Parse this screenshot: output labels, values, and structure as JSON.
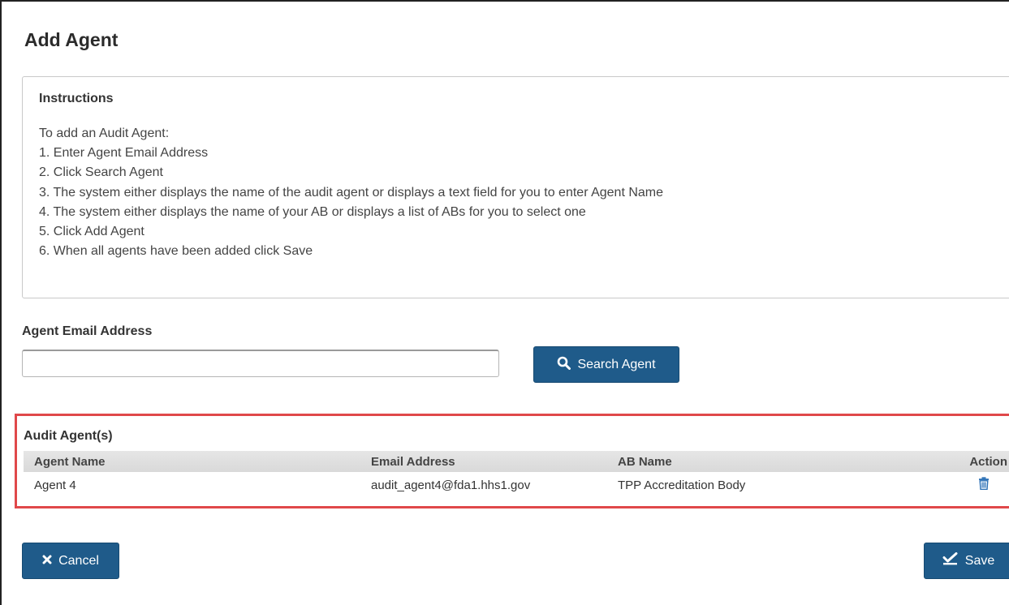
{
  "page": {
    "title": "Add Agent"
  },
  "instructions": {
    "title": "Instructions",
    "lines": [
      "To add an Audit Agent:",
      "1. Enter Agent Email Address",
      "2. Click Search Agent",
      "3. The system either displays the name of the audit agent or displays a text field for you to enter Agent Name",
      "4. The system either displays the name of your AB or displays a list of ABs for you to select one",
      "5. Click Add Agent",
      "6. When all agents have been added click Save"
    ]
  },
  "search": {
    "label": "Agent Email Address",
    "value": "",
    "placeholder": "",
    "button_label": "Search Agent",
    "button_icon": "search-icon"
  },
  "agents": {
    "title": "Audit Agent(s)",
    "columns": [
      "Agent Name",
      "Email Address",
      "AB Name",
      "Action"
    ],
    "rows": [
      {
        "agent_name": "Agent 4",
        "email": "audit_agent4@fda1.hhs1.gov",
        "ab_name": "TPP Accreditation Body",
        "action_icon": "trash-icon"
      }
    ]
  },
  "footer": {
    "cancel_label": "Cancel",
    "cancel_icon": "close-icon",
    "save_label": "Save",
    "save_icon": "checkmark-icon"
  },
  "colors": {
    "button_bg": "#1f5b8a",
    "highlight_border": "#e0484a",
    "trash_icon": "#2a6fb5"
  }
}
